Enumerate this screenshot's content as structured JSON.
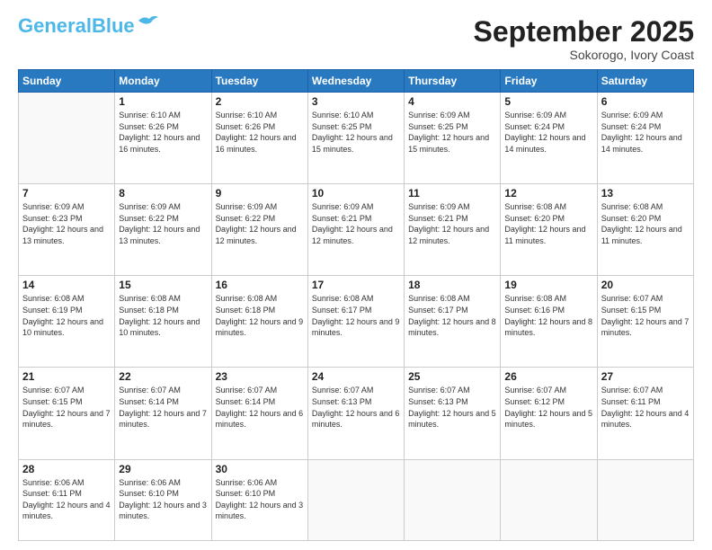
{
  "logo": {
    "line1": "General",
    "line2": "Blue"
  },
  "header": {
    "month": "September 2025",
    "location": "Sokorogo, Ivory Coast"
  },
  "weekdays": [
    "Sunday",
    "Monday",
    "Tuesday",
    "Wednesday",
    "Thursday",
    "Friday",
    "Saturday"
  ],
  "weeks": [
    [
      {
        "day": "",
        "sunrise": "",
        "sunset": "",
        "daylight": ""
      },
      {
        "day": "1",
        "sunrise": "Sunrise: 6:10 AM",
        "sunset": "Sunset: 6:26 PM",
        "daylight": "Daylight: 12 hours and 16 minutes."
      },
      {
        "day": "2",
        "sunrise": "Sunrise: 6:10 AM",
        "sunset": "Sunset: 6:26 PM",
        "daylight": "Daylight: 12 hours and 16 minutes."
      },
      {
        "day": "3",
        "sunrise": "Sunrise: 6:10 AM",
        "sunset": "Sunset: 6:25 PM",
        "daylight": "Daylight: 12 hours and 15 minutes."
      },
      {
        "day": "4",
        "sunrise": "Sunrise: 6:09 AM",
        "sunset": "Sunset: 6:25 PM",
        "daylight": "Daylight: 12 hours and 15 minutes."
      },
      {
        "day": "5",
        "sunrise": "Sunrise: 6:09 AM",
        "sunset": "Sunset: 6:24 PM",
        "daylight": "Daylight: 12 hours and 14 minutes."
      },
      {
        "day": "6",
        "sunrise": "Sunrise: 6:09 AM",
        "sunset": "Sunset: 6:24 PM",
        "daylight": "Daylight: 12 hours and 14 minutes."
      }
    ],
    [
      {
        "day": "7",
        "sunrise": "Sunrise: 6:09 AM",
        "sunset": "Sunset: 6:23 PM",
        "daylight": "Daylight: 12 hours and 13 minutes."
      },
      {
        "day": "8",
        "sunrise": "Sunrise: 6:09 AM",
        "sunset": "Sunset: 6:22 PM",
        "daylight": "Daylight: 12 hours and 13 minutes."
      },
      {
        "day": "9",
        "sunrise": "Sunrise: 6:09 AM",
        "sunset": "Sunset: 6:22 PM",
        "daylight": "Daylight: 12 hours and 12 minutes."
      },
      {
        "day": "10",
        "sunrise": "Sunrise: 6:09 AM",
        "sunset": "Sunset: 6:21 PM",
        "daylight": "Daylight: 12 hours and 12 minutes."
      },
      {
        "day": "11",
        "sunrise": "Sunrise: 6:09 AM",
        "sunset": "Sunset: 6:21 PM",
        "daylight": "Daylight: 12 hours and 12 minutes."
      },
      {
        "day": "12",
        "sunrise": "Sunrise: 6:08 AM",
        "sunset": "Sunset: 6:20 PM",
        "daylight": "Daylight: 12 hours and 11 minutes."
      },
      {
        "day": "13",
        "sunrise": "Sunrise: 6:08 AM",
        "sunset": "Sunset: 6:20 PM",
        "daylight": "Daylight: 12 hours and 11 minutes."
      }
    ],
    [
      {
        "day": "14",
        "sunrise": "Sunrise: 6:08 AM",
        "sunset": "Sunset: 6:19 PM",
        "daylight": "Daylight: 12 hours and 10 minutes."
      },
      {
        "day": "15",
        "sunrise": "Sunrise: 6:08 AM",
        "sunset": "Sunset: 6:18 PM",
        "daylight": "Daylight: 12 hours and 10 minutes."
      },
      {
        "day": "16",
        "sunrise": "Sunrise: 6:08 AM",
        "sunset": "Sunset: 6:18 PM",
        "daylight": "Daylight: 12 hours and 9 minutes."
      },
      {
        "day": "17",
        "sunrise": "Sunrise: 6:08 AM",
        "sunset": "Sunset: 6:17 PM",
        "daylight": "Daylight: 12 hours and 9 minutes."
      },
      {
        "day": "18",
        "sunrise": "Sunrise: 6:08 AM",
        "sunset": "Sunset: 6:17 PM",
        "daylight": "Daylight: 12 hours and 8 minutes."
      },
      {
        "day": "19",
        "sunrise": "Sunrise: 6:08 AM",
        "sunset": "Sunset: 6:16 PM",
        "daylight": "Daylight: 12 hours and 8 minutes."
      },
      {
        "day": "20",
        "sunrise": "Sunrise: 6:07 AM",
        "sunset": "Sunset: 6:15 PM",
        "daylight": "Daylight: 12 hours and 7 minutes."
      }
    ],
    [
      {
        "day": "21",
        "sunrise": "Sunrise: 6:07 AM",
        "sunset": "Sunset: 6:15 PM",
        "daylight": "Daylight: 12 hours and 7 minutes."
      },
      {
        "day": "22",
        "sunrise": "Sunrise: 6:07 AM",
        "sunset": "Sunset: 6:14 PM",
        "daylight": "Daylight: 12 hours and 7 minutes."
      },
      {
        "day": "23",
        "sunrise": "Sunrise: 6:07 AM",
        "sunset": "Sunset: 6:14 PM",
        "daylight": "Daylight: 12 hours and 6 minutes."
      },
      {
        "day": "24",
        "sunrise": "Sunrise: 6:07 AM",
        "sunset": "Sunset: 6:13 PM",
        "daylight": "Daylight: 12 hours and 6 minutes."
      },
      {
        "day": "25",
        "sunrise": "Sunrise: 6:07 AM",
        "sunset": "Sunset: 6:13 PM",
        "daylight": "Daylight: 12 hours and 5 minutes."
      },
      {
        "day": "26",
        "sunrise": "Sunrise: 6:07 AM",
        "sunset": "Sunset: 6:12 PM",
        "daylight": "Daylight: 12 hours and 5 minutes."
      },
      {
        "day": "27",
        "sunrise": "Sunrise: 6:07 AM",
        "sunset": "Sunset: 6:11 PM",
        "daylight": "Daylight: 12 hours and 4 minutes."
      }
    ],
    [
      {
        "day": "28",
        "sunrise": "Sunrise: 6:06 AM",
        "sunset": "Sunset: 6:11 PM",
        "daylight": "Daylight: 12 hours and 4 minutes."
      },
      {
        "day": "29",
        "sunrise": "Sunrise: 6:06 AM",
        "sunset": "Sunset: 6:10 PM",
        "daylight": "Daylight: 12 hours and 3 minutes."
      },
      {
        "day": "30",
        "sunrise": "Sunrise: 6:06 AM",
        "sunset": "Sunset: 6:10 PM",
        "daylight": "Daylight: 12 hours and 3 minutes."
      },
      {
        "day": "",
        "sunrise": "",
        "sunset": "",
        "daylight": ""
      },
      {
        "day": "",
        "sunrise": "",
        "sunset": "",
        "daylight": ""
      },
      {
        "day": "",
        "sunrise": "",
        "sunset": "",
        "daylight": ""
      },
      {
        "day": "",
        "sunrise": "",
        "sunset": "",
        "daylight": ""
      }
    ]
  ]
}
